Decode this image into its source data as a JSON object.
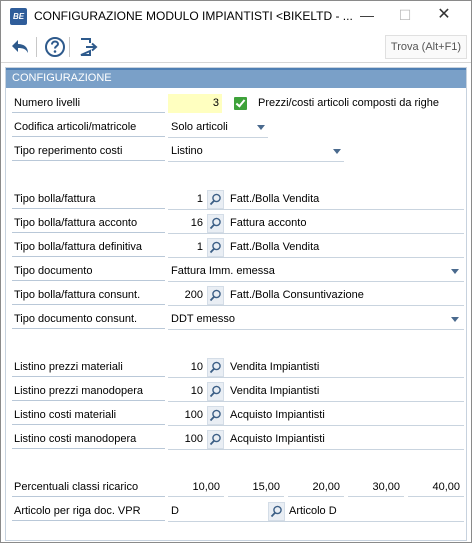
{
  "window": {
    "title": "CONFIGURAZIONE MODULO IMPIANTISTI <BIKELTD - ...",
    "app_icon_text": "BE"
  },
  "toolbar": {
    "search_label": "Trova (Alt+F1)"
  },
  "section": {
    "title": "CONFIGURAZIONE"
  },
  "fields": {
    "numero_livelli": {
      "label": "Numero livelli",
      "value": "3"
    },
    "prezzi_costi": {
      "label": "Prezzi/costi articoli composti da righe",
      "checked": true
    },
    "codifica": {
      "label": "Codifica articoli/matricole",
      "value": "Solo articoli"
    },
    "tipo_reperimento": {
      "label": "Tipo reperimento costi",
      "value": "Listino"
    },
    "tipo_bolla": {
      "label": "Tipo bolla/fattura",
      "value": "1",
      "desc": "Fatt./Bolla Vendita"
    },
    "tipo_bolla_acconto": {
      "label": "Tipo bolla/fattura acconto",
      "value": "16",
      "desc": "Fattura acconto"
    },
    "tipo_bolla_definitiva": {
      "label": "Tipo bolla/fattura definitiva",
      "value": "1",
      "desc": "Fatt./Bolla Vendita"
    },
    "tipo_documento": {
      "label": "Tipo documento",
      "value": "Fattura Imm. emessa"
    },
    "tipo_bolla_consunt": {
      "label": "Tipo bolla/fattura consunt.",
      "value": "200",
      "desc": "Fatt./Bolla Consuntivazione"
    },
    "tipo_documento_consunt": {
      "label": "Tipo documento consunt.",
      "value": "DDT emesso"
    },
    "listino_prezzi_materiali": {
      "label": "Listino prezzi materiali",
      "value": "10",
      "desc": "Vendita Impiantisti"
    },
    "listino_prezzi_manodopera": {
      "label": "Listino prezzi manodopera",
      "value": "10",
      "desc": "Vendita Impiantisti"
    },
    "listino_costi_materiali": {
      "label": "Listino costi materiali",
      "value": "100",
      "desc": "Acquisto Impiantisti"
    },
    "listino_costi_manodopera": {
      "label": "Listino costi manodopera",
      "value": "100",
      "desc": "Acquisto Impiantisti"
    },
    "percentuali": {
      "label": "Percentuali classi ricarico",
      "values": [
        "10,00",
        "15,00",
        "20,00",
        "30,00",
        "40,00"
      ]
    },
    "articolo_vpr": {
      "label": "Articolo per riga doc. VPR",
      "value": "D",
      "desc": "Articolo D"
    }
  },
  "colors": {
    "section_header": "#7aa0c8",
    "check_green": "#3ea23a",
    "highlight_yellow": "#ffffc0"
  },
  "icons": [
    "back-arrow-icon",
    "help-icon",
    "exit-icon",
    "search-icon",
    "chevron-down-icon",
    "checkbox-icon"
  ]
}
